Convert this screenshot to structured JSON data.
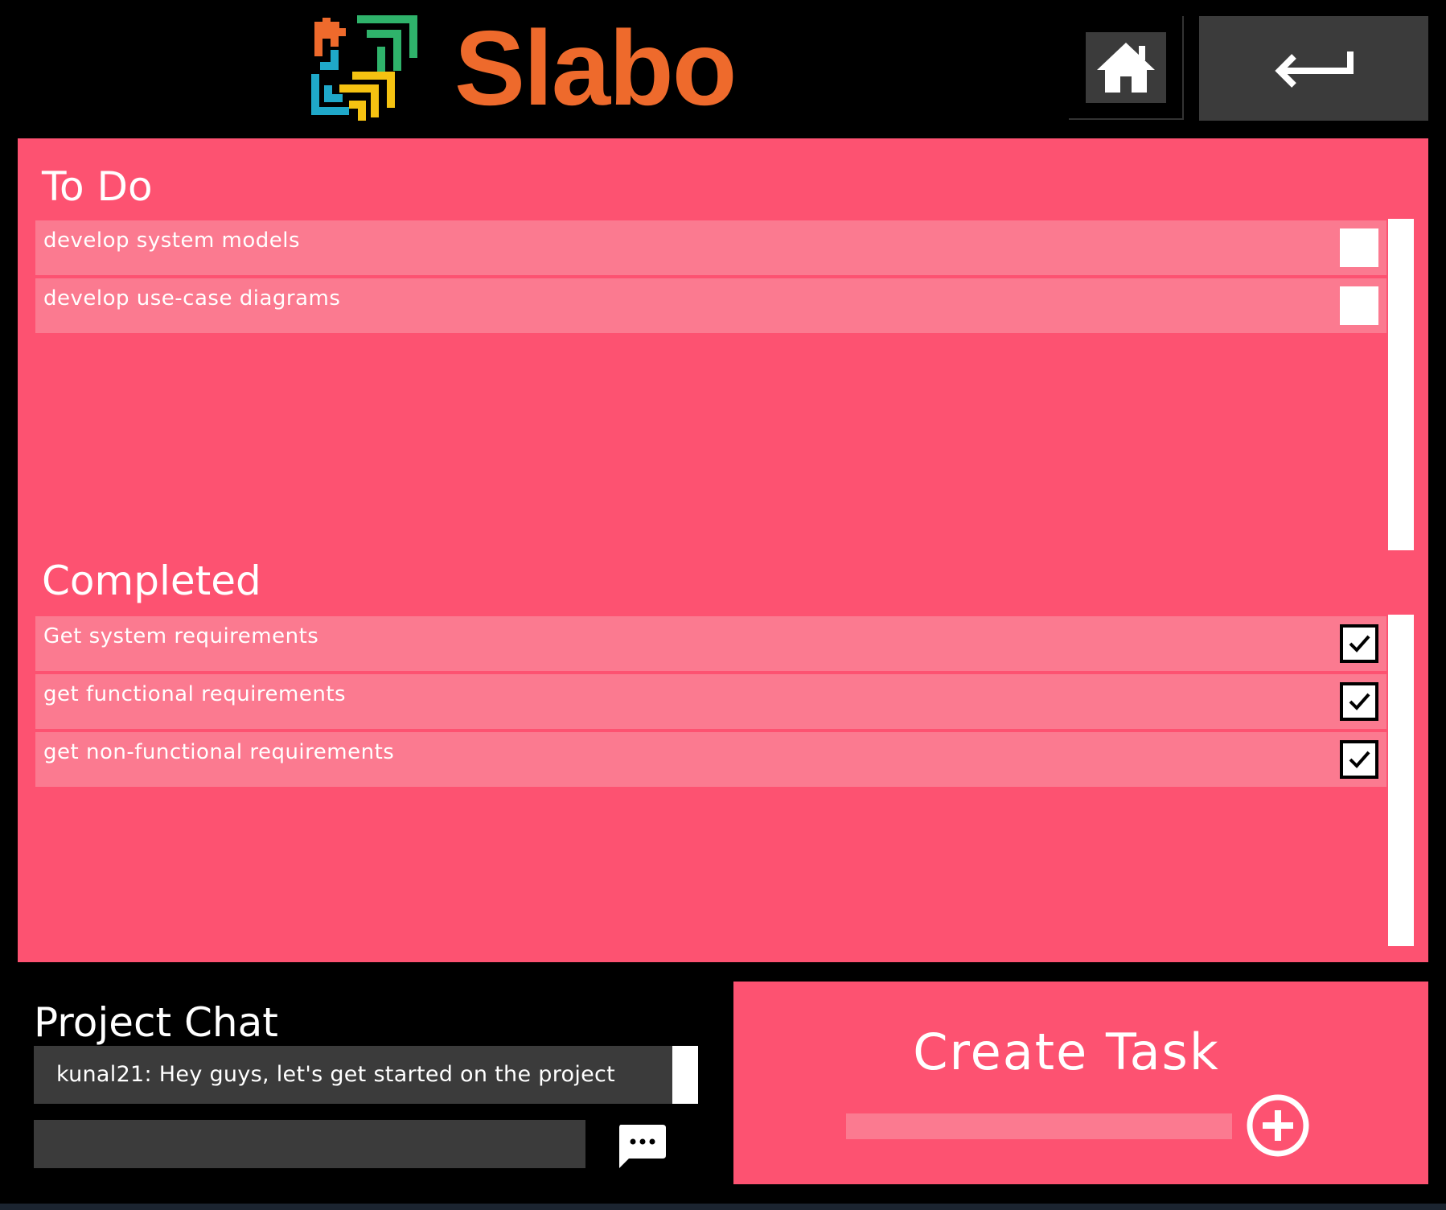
{
  "header": {
    "app_name": "Slabo",
    "home_icon": "home-icon",
    "back_icon": "back-arrow-icon"
  },
  "colors": {
    "panel": "#fd5271",
    "row": "#fb7a90",
    "brand_text": "#ee6a2c",
    "dark_control": "#3b3b3b"
  },
  "todo": {
    "title": "To Do",
    "items": [
      {
        "label": "develop system models",
        "checked": false
      },
      {
        "label": "develop use-case diagrams",
        "checked": false
      }
    ]
  },
  "completed": {
    "title": "Completed",
    "items": [
      {
        "label": "Get system requirements",
        "checked": true
      },
      {
        "label": "get functional requirements",
        "checked": true
      },
      {
        "label": "get non-functional requirements",
        "checked": true
      }
    ]
  },
  "chat": {
    "title": "Project Chat",
    "messages": [
      {
        "text": "kunal21:  Hey guys, let's get started on the project"
      }
    ],
    "input_value": "",
    "send_icon": "chat-bubble-icon"
  },
  "create_task": {
    "title": "Create Task",
    "input_value": "",
    "add_icon": "plus-circle-icon"
  }
}
